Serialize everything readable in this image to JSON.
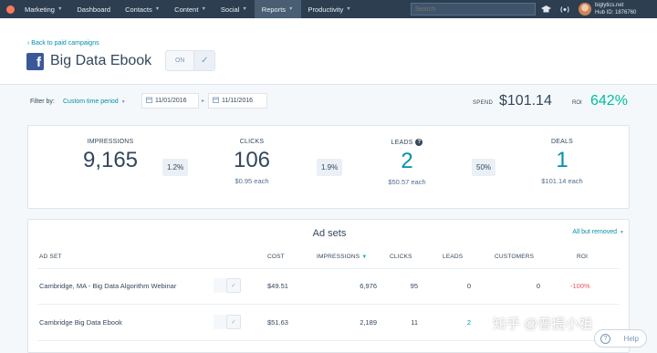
{
  "nav": {
    "items": [
      {
        "label": "Marketing",
        "caret": true
      },
      {
        "label": "Dashboard",
        "caret": false
      },
      {
        "label": "Contacts",
        "caret": true
      },
      {
        "label": "Content",
        "caret": true
      },
      {
        "label": "Social",
        "caret": true
      },
      {
        "label": "Reports",
        "caret": true
      },
      {
        "label": "Productivity",
        "caret": true
      }
    ],
    "active": "Reports",
    "search_placeholder": "Search",
    "account_domain": "biglytics.net",
    "hub_id": "Hub ID: 1876760"
  },
  "header": {
    "back_link": "‹  Back to paid campaigns",
    "title": "Big Data Ebook",
    "toggle_label": "ON",
    "toggle_check": "✓"
  },
  "filters": {
    "label": "Filter by:",
    "period": "Custom time period",
    "start_date": "11/01/2016",
    "end_date": "11/11/2016",
    "spend_label": "SPEND",
    "spend_value": "$101.14",
    "roi_label": "ROI",
    "roi_value": "642%"
  },
  "metrics": {
    "impressions": {
      "label": "IMPRESSIONS",
      "value": "9,165"
    },
    "clicks": {
      "label": "CLICKS",
      "value": "106",
      "sub": "$0.95 each"
    },
    "leads": {
      "label": "LEADS",
      "value": "2",
      "sub": "$50.57 each"
    },
    "deals": {
      "label": "DEALS",
      "value": "1",
      "sub": "$101.14 each"
    },
    "rate1": "1.2%",
    "rate2": "1.9%",
    "rate3": "50%"
  },
  "adsets": {
    "title": "Ad sets",
    "filter": "All but removed",
    "columns": {
      "adset": "AD SET",
      "cost": "COST",
      "impressions": "IMPRESSIONS",
      "clicks": "CLICKS",
      "leads": "LEADS",
      "customers": "CUSTOMERS",
      "roi": "ROI"
    },
    "rows": [
      {
        "name": "Cambridge, MA - Big Data Algorithm Webinar",
        "cost": "$49.51",
        "impressions": "6,976",
        "clicks": "95",
        "leads": "0",
        "customers": "0",
        "roi": "-100%"
      },
      {
        "name": "Cambridge Big Data Ebook",
        "cost": "$51.63",
        "impressions": "2,189",
        "clicks": "11",
        "leads": "2",
        "customers": "",
        "roi": ""
      }
    ]
  },
  "watermark": "知乎 @普提小祖",
  "help_label": "Help"
}
